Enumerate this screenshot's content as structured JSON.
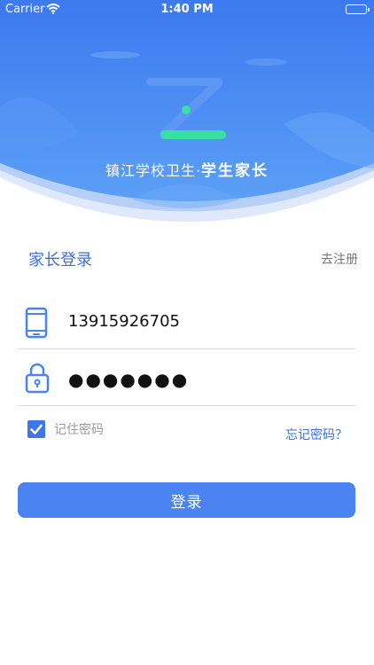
{
  "status_bar": {
    "carrier": "Carrier",
    "time": "1:40 PM",
    "icons": [
      "wifi-icon",
      "battery-icon"
    ]
  },
  "header": {
    "logo_icon": "z-logo-icon",
    "app_name_prefix": "镇江学校卫生·",
    "app_name_strong": "学生家长",
    "colors": {
      "banner_top": "#3e7bf0",
      "banner_bottom": "#5aa0f7",
      "logo_accent": "#38e0a4"
    }
  },
  "login": {
    "title": "家长登录",
    "register_label": "去注册",
    "phone": {
      "icon": "phone-icon",
      "value": "13915926705"
    },
    "password": {
      "icon": "lock-icon",
      "value": "●●●●●●●"
    },
    "remember": {
      "label": "记住密码",
      "checked": true
    },
    "forgot_label": "忘记密码？",
    "submit_label": "登录",
    "colors": {
      "primary": "#4b84f2",
      "link": "#3d6fd6"
    }
  }
}
